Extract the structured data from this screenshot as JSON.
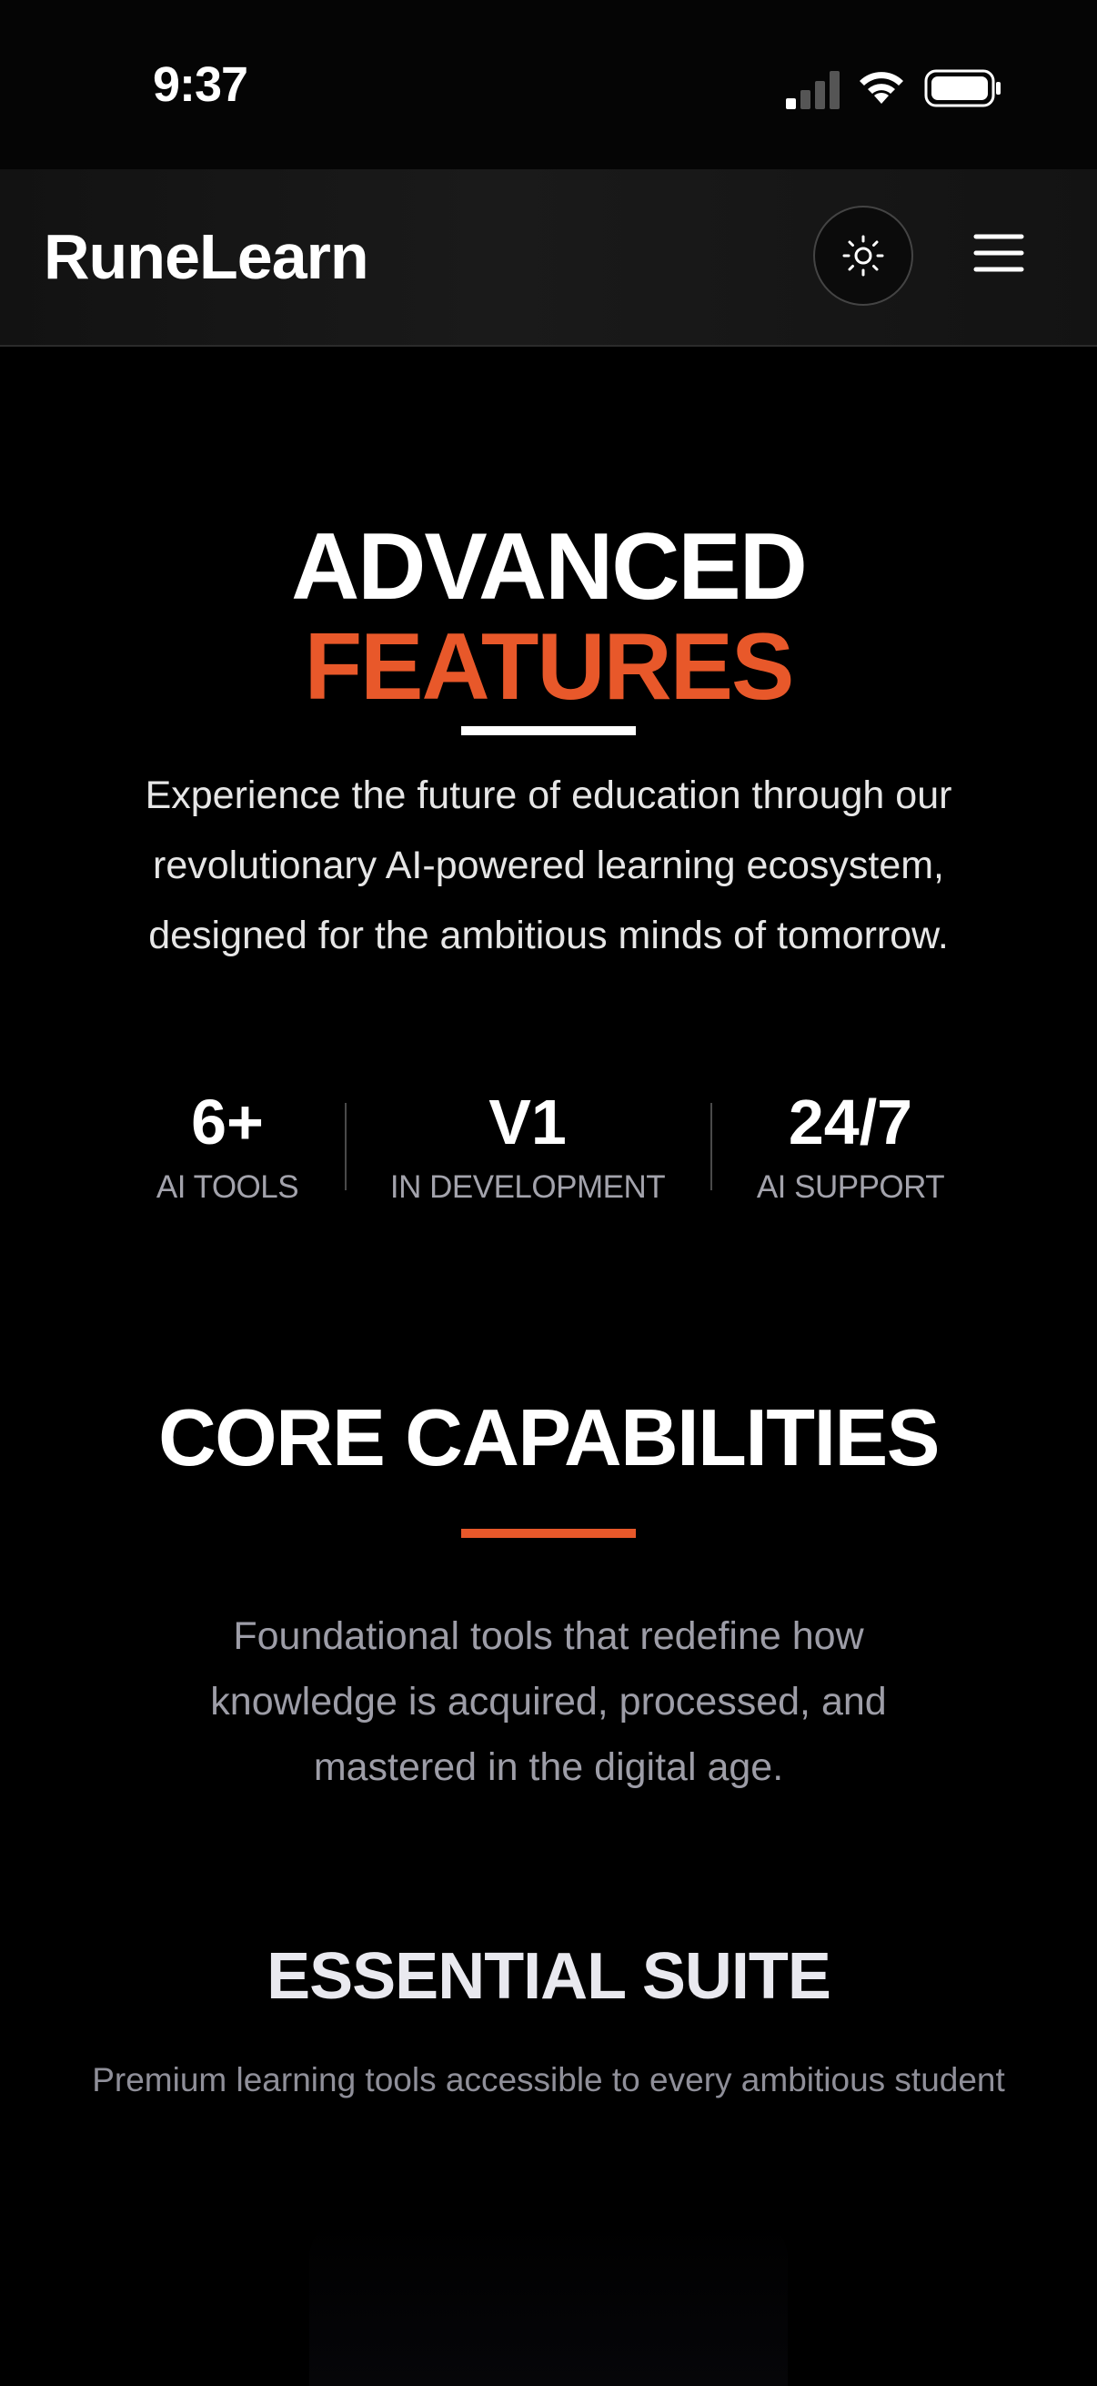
{
  "status_bar": {
    "time": "9:37"
  },
  "header": {
    "brand": "RuneLearn",
    "theme_toggle_icon": "sun-icon",
    "menu_icon": "hamburger-icon"
  },
  "hero": {
    "title_line1": "ADVANCED",
    "title_line2": "FEATURES",
    "description": "Experience the future of education through our revolutionary AI-powered learning ecosystem, designed for the ambitious minds of tomorrow."
  },
  "stats": [
    {
      "value": "6+",
      "label": "AI TOOLS"
    },
    {
      "value": "V1",
      "label": "IN DEVELOPMENT"
    },
    {
      "value": "24/7",
      "label": "AI SUPPORT"
    }
  ],
  "core": {
    "title": "CORE CAPABILITIES",
    "description": "Foundational tools that redefine how knowledge is acquired, processed, and mastered in the digital age."
  },
  "suite": {
    "title": "ESSENTIAL SUITE",
    "description": "Premium learning tools accessible to every ambitious student"
  },
  "colors": {
    "accent": "#e8582a",
    "background": "#000000",
    "text": "#ffffff",
    "muted_text": "#9d9da7"
  }
}
